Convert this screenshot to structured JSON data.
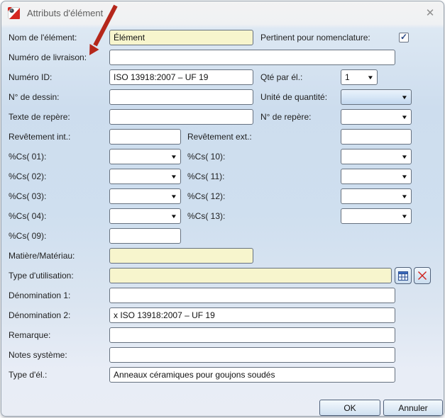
{
  "window": {
    "title": "Attributs d'élément"
  },
  "glyphs": {
    "dropdown_arrow": "▼",
    "check": "✓",
    "close": "✕"
  },
  "colors": {
    "field_highlight_yellow": "#f7f5cd",
    "annotation_arrow_red": "#b5271b",
    "focused_dropdown_blue": "#c3d8ef",
    "app_icon_red": "#d5261f"
  },
  "fields": {
    "nom": {
      "label": "Nom de l'élément:",
      "value": "Élément"
    },
    "pertinent": {
      "label": "Pertinent pour nomenclature:",
      "checked": true
    },
    "livraison": {
      "label": "Numéro de livraison:",
      "value": ""
    },
    "numero_id": {
      "label": "Numéro ID:",
      "value": "ISO 13918:2007 – UF 19"
    },
    "qte": {
      "label": "Qté par él.:",
      "value": "1"
    },
    "dessin": {
      "label": "N° de dessin:",
      "value": ""
    },
    "unite": {
      "label": "Unité de quantité:",
      "value": ""
    },
    "texte_repere": {
      "label": "Texte de repère:",
      "value": ""
    },
    "no_repere": {
      "label": "N° de repère:",
      "value": ""
    },
    "rev_int": {
      "label": "Revêtement int.:",
      "value": ""
    },
    "rev_ext": {
      "label": "Revêtement ext.:",
      "value": ""
    },
    "cs01": {
      "label": "%Cs( 01):",
      "value": ""
    },
    "cs02": {
      "label": "%Cs( 02):",
      "value": ""
    },
    "cs03": {
      "label": "%Cs( 03):",
      "value": ""
    },
    "cs04": {
      "label": "%Cs( 04):",
      "value": ""
    },
    "cs09": {
      "label": "%Cs( 09):",
      "value": ""
    },
    "cs10": {
      "label": "%Cs( 10):",
      "value": ""
    },
    "cs11": {
      "label": "%Cs( 11):",
      "value": ""
    },
    "cs12": {
      "label": "%Cs( 12):",
      "value": ""
    },
    "cs13": {
      "label": "%Cs( 13):",
      "value": ""
    },
    "matiere": {
      "label": "Matière/Matériau:",
      "value": ""
    },
    "type_utilisation": {
      "label": "Type d'utilisation:",
      "value": ""
    },
    "denom1": {
      "label": "Dénomination 1:",
      "value": ""
    },
    "denom2": {
      "label": "Dénomination 2:",
      "value": "x ISO 13918:2007 – UF 19"
    },
    "remarque": {
      "label": "Remarque:",
      "value": ""
    },
    "notes": {
      "label": "Notes système:",
      "value": ""
    },
    "type_el": {
      "label": "Type d'él.:",
      "value": "Anneaux céramiques pour goujons soudés"
    }
  },
  "buttons": {
    "ok": "OK",
    "cancel": "Annuler"
  },
  "icons": {
    "app": "stud-welding-app-icon",
    "browse": "table-browse-icon",
    "clear": "clear-red-x-icon"
  }
}
